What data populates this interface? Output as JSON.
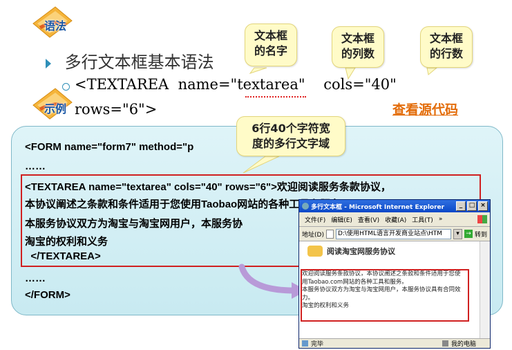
{
  "header": {
    "syntax_badge": "语法",
    "example_badge": "示例"
  },
  "bullets": {
    "main": "多行文本框基本语法",
    "sub_line1": "<TEXTAREA  name=\"textarea\"    cols=\"40\"",
    "sub_line2": "rows=\"6\">"
  },
  "callouts": {
    "name": "文本框\n的名字",
    "cols": "文本框\n的列数",
    "rows": "文本框\n的行数",
    "area": "6行40个字符宽\n度的多行文字域"
  },
  "view_source_link": "查看源代码",
  "code": {
    "line1": "<FORM name=\"form7\" method=\"p",
    "line2": "……",
    "line3": "<TEXTAREA name=\"textarea\" cols=\"40\" rows=\"6\">欢迎阅读服务条款协议，",
    "line4": "本协议阐述之条款和条件适用于您使用Taobao网站的各种工具和服务。",
    "line5": "本服务协议双方为淘宝与淘宝网用户，本服务协",
    "line6": "淘宝的权利和义务",
    "line7": "  </TEXTAREA>",
    "line8": "……",
    "line9": "</FORM>"
  },
  "browser": {
    "title": "多行文本框 - Microsoft Internet Explorer",
    "menu": [
      "文件(F)",
      "编辑(E)",
      "查看(V)",
      "收藏(A)",
      "工具(T)"
    ],
    "menu_more": "»",
    "address_label": "地址(D)",
    "address_value": "D:\\使用HTML语言开发商业站点\\HTM",
    "go_button": "转到",
    "page_heading": "阅读淘宝网服务协议",
    "textarea_text": "欢迎阅读服务条款协议，本协议阐述之条款和条件适用于您使用Taobao.com网站的各种工具和服务。\n本服务协议双方为淘宝与淘宝网用户，本服务协议具有合同效力。\n淘宝的权利和义务",
    "status_left": "完毕",
    "status_right": "我的电脑"
  },
  "colors": {
    "accent": "#1a57a6",
    "link": "#e36c09",
    "highlight_border": "#d02020",
    "panel": "#cdebf2"
  }
}
